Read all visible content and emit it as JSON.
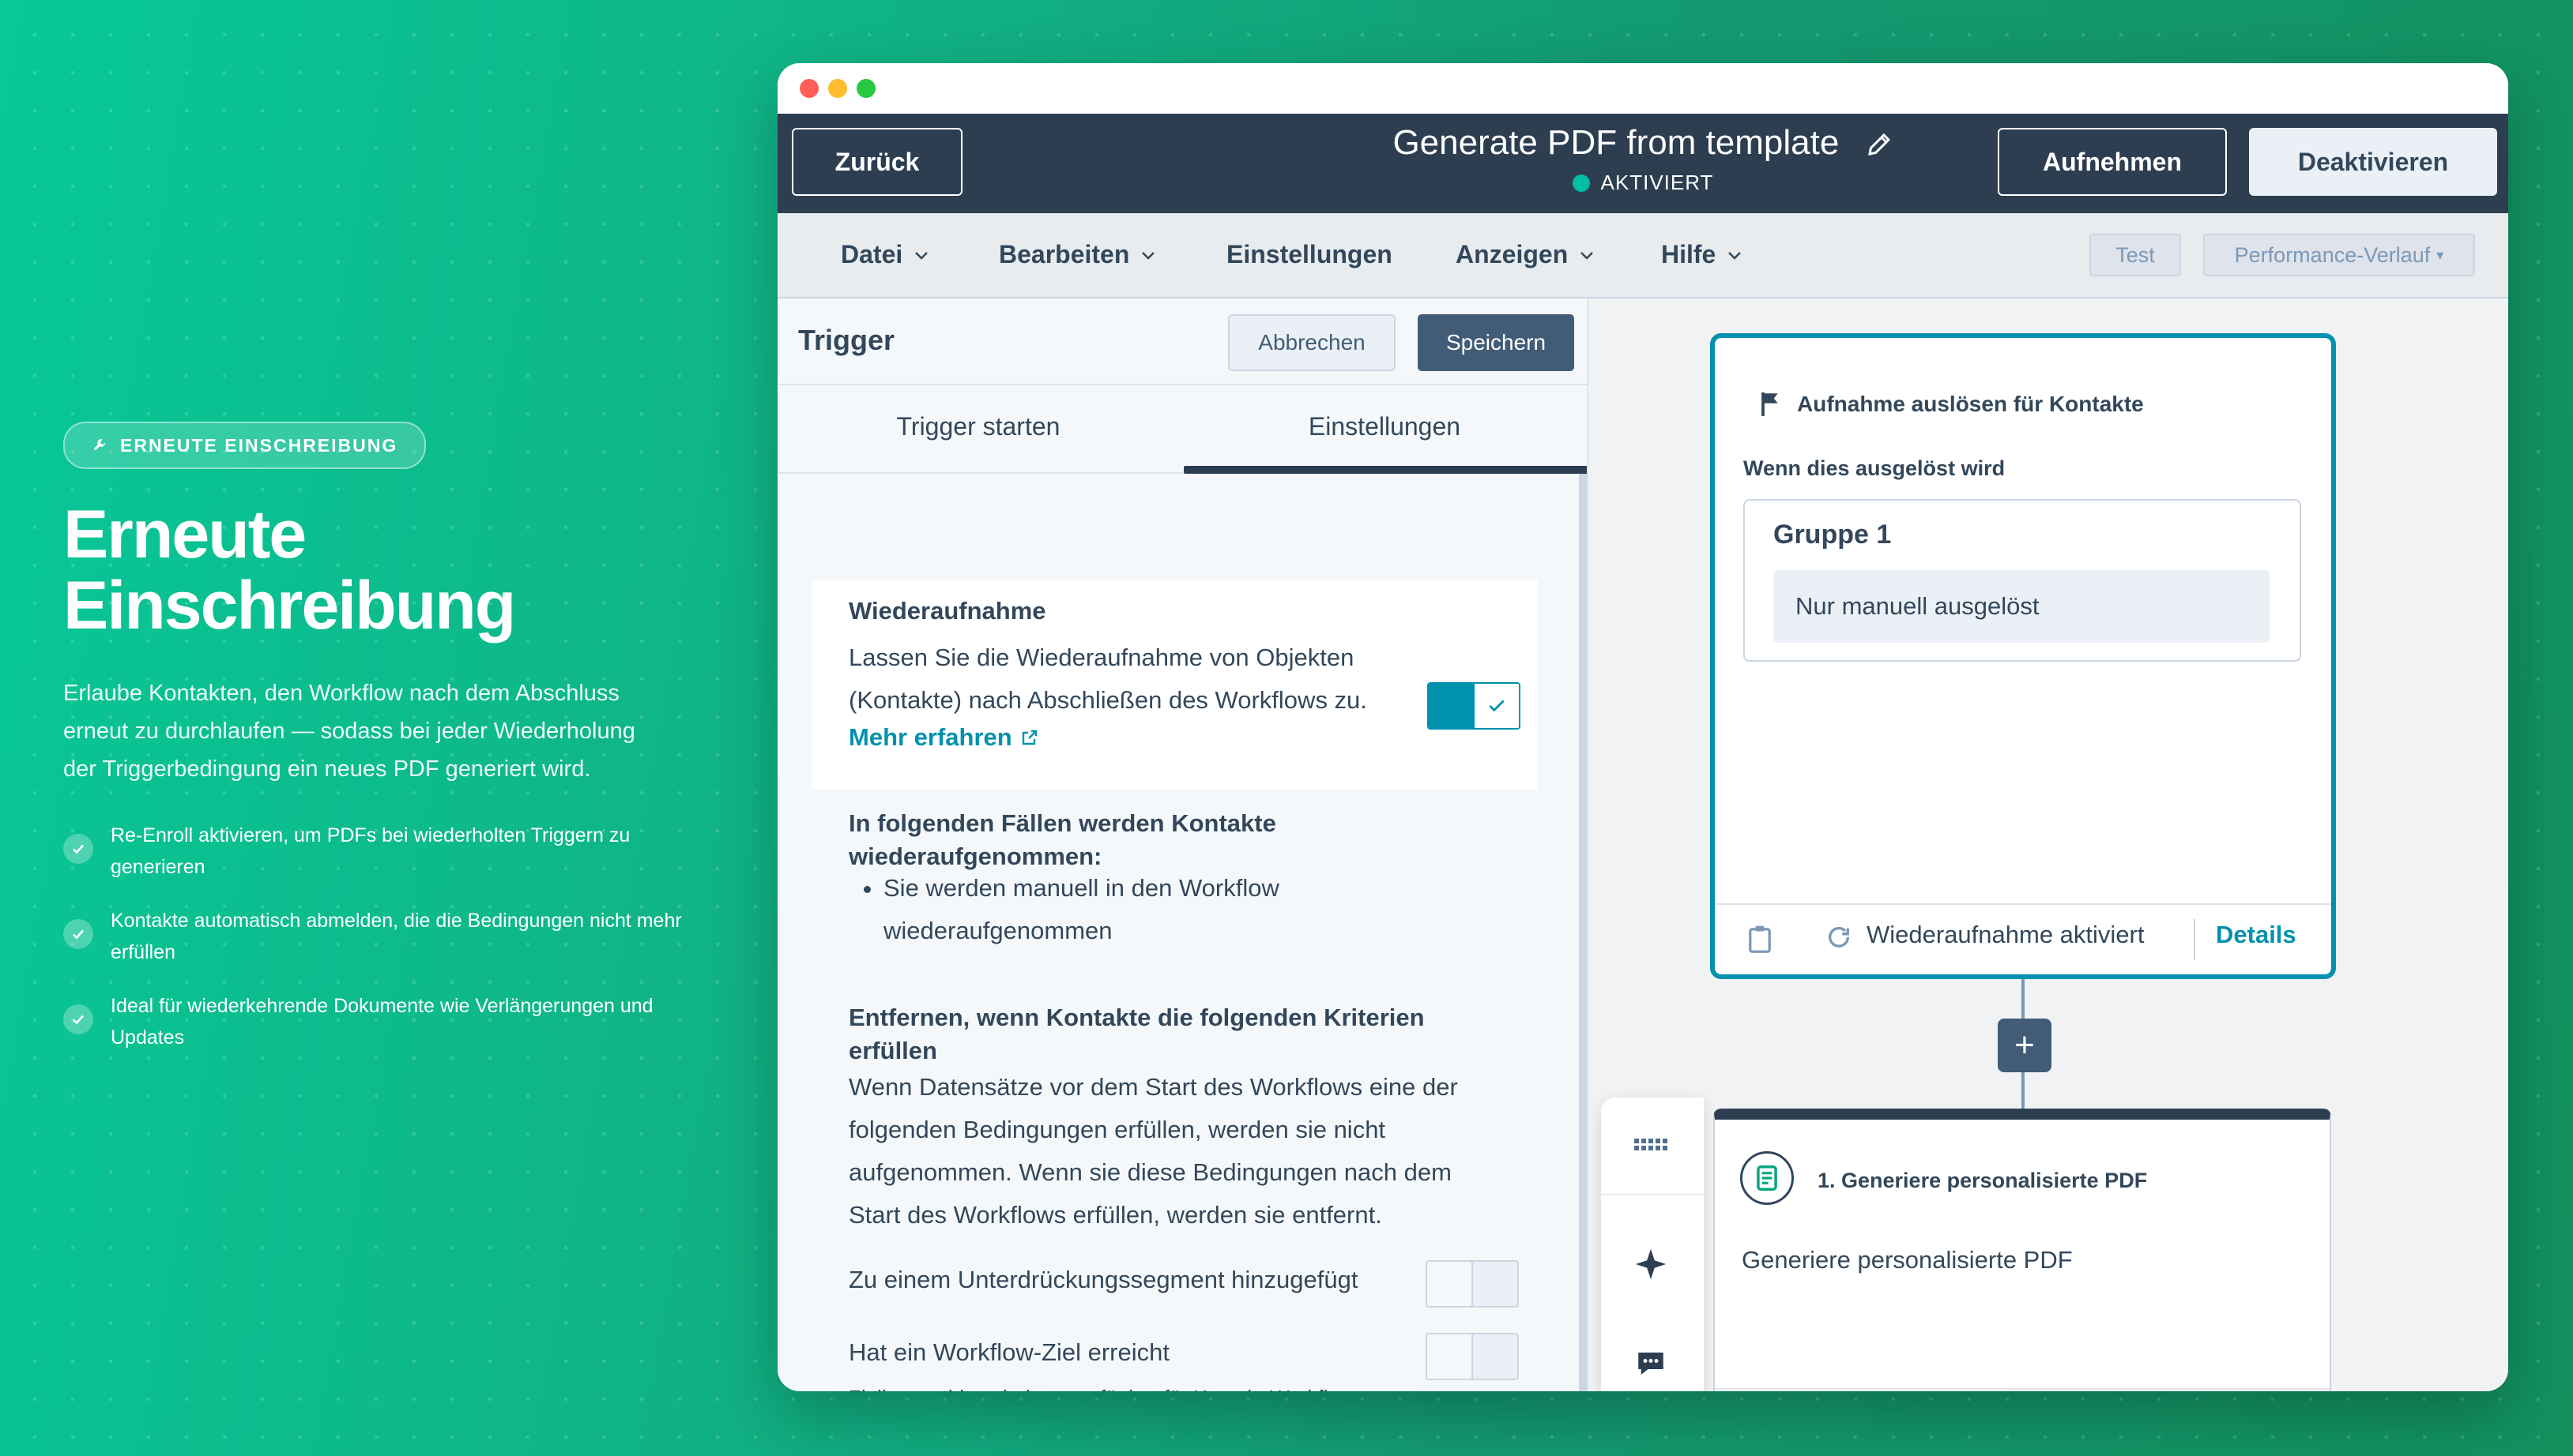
{
  "marketing": {
    "badge": "ERNEUTE EINSCHREIBUNG",
    "title_line1": "Erneute",
    "title_line2": "Einschreibung",
    "description": "Erlaube Kontakten, den Workflow nach dem Abschluss erneut zu durchlaufen — sodass bei jeder Wiederholung der Triggerbedingung ein neues PDF generiert wird.",
    "bullets": [
      "Re-Enroll aktivieren, um PDFs bei wiederholten Triggern zu generieren",
      "Kontakte automatisch abmelden, die die Bedingungen nicht mehr erfüllen",
      "Ideal für wiederkehrende Dokumente wie Verlängerungen und Updates"
    ]
  },
  "header": {
    "back_label": "Zurück",
    "title": "Generate PDF from template",
    "status": "AKTIVIERT",
    "enroll_label": "Aufnehmen",
    "deactivate_label": "Deaktivieren"
  },
  "menu": {
    "items": [
      "Datei",
      "Bearbeiten",
      "Einstellungen",
      "Anzeigen",
      "Hilfe"
    ],
    "test_label": "Test",
    "performance_label": "Performance-Verlauf"
  },
  "panel": {
    "title": "Trigger",
    "cancel_label": "Abbrechen",
    "save_label": "Speichern",
    "tabs": [
      "Trigger starten",
      "Einstellungen"
    ],
    "reenroll": {
      "heading": "Wiederaufnahme",
      "text": "Lassen Sie die Wiederaufnahme von Objekten (Kontakte) nach Abschließen des Workflows zu.",
      "link": "Mehr erfahren",
      "enabled": true
    },
    "cases_heading": "In folgenden Fällen werden Kontakte wiederaufgenommen:",
    "cases": [
      "Sie werden manuell in den Workflow wiederaufgenommen"
    ],
    "remove_heading": "Entfernen, wenn Kontakte die folgenden Kriterien erfüllen",
    "remove_text": "Wenn Datensätze vor dem Start des Workflows eine der folgenden Bedingungen erfüllen, werden sie nicht aufgenommen. Wenn sie diese Bedingungen nach dem Start des Workflows erfüllen, werden sie entfernt.",
    "suppression_label": "Zu einem Unterdrückungssegment hinzugefügt",
    "goal_label": "Hat ein Workflow-Ziel erreicht",
    "goal_note": "Zielkennzahlen sind nur verfügbar für Kontakt-Workflows mit E-Mail-Aktionen. Zielbedingungen werden"
  },
  "canvas": {
    "trigger_title": "Aufnahme auslösen für Kontakte",
    "when_label": "Wenn dies ausgelöst wird",
    "group_title": "Gruppe 1",
    "group_condition": "Nur manuell ausgelöst",
    "reenroll_status": "Wiederaufnahme aktiviert",
    "details_label": "Details",
    "plus_label": "+",
    "action_title": "1. Generiere personalisierte PDF",
    "action_text": "Generiere personalisierte PDF"
  },
  "colors": {
    "header_bg": "#2d3e50",
    "accent": "#0091ae",
    "status_dot": "#00bda5",
    "background_green": "#10b486"
  }
}
